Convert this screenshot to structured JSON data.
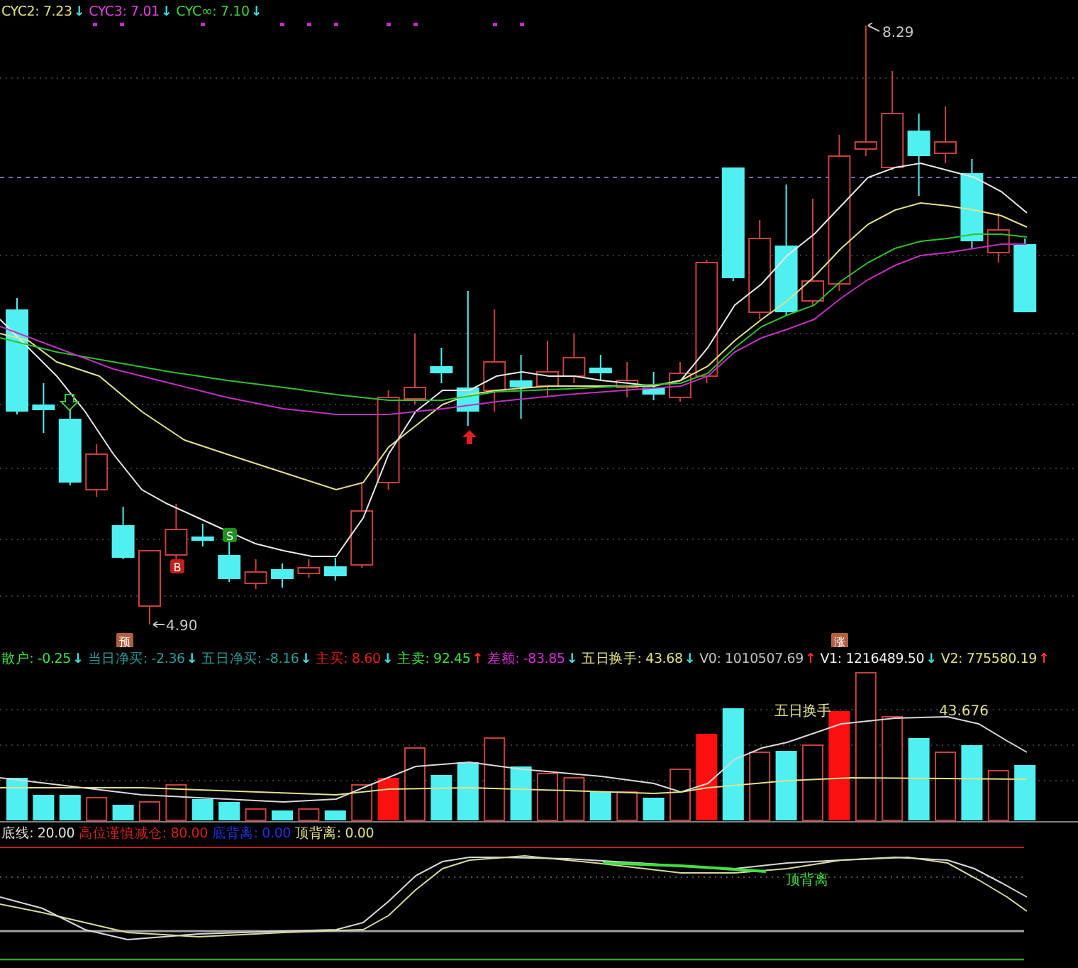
{
  "price_legend": [
    {
      "label": "CYC2:",
      "value": "7.23",
      "arrow": "↓",
      "rising": false,
      "color": "#e0e080"
    },
    {
      "label": "CYC3:",
      "value": "7.01",
      "arrow": "↓",
      "rising": false,
      "color": "#e040e0"
    },
    {
      "label": "CYC∞:",
      "value": "7.10",
      "arrow": "↓",
      "rising": false,
      "color": "#40d040"
    }
  ],
  "price_chart": {
    "high_label": "8.29",
    "low_label": "4.90",
    "buy_badge": "B",
    "sell_badge": "S",
    "marker_1": "预",
    "marker_2": "涨"
  },
  "indicator_legend": [
    {
      "label": "散户:",
      "value": "-0.25",
      "arrow": "↓",
      "rising": false,
      "color": "#40e040"
    },
    {
      "label": "当日净买:",
      "value": "-2.36",
      "arrow": "↓",
      "rising": false,
      "color": "#2a9a9a"
    },
    {
      "label": "五日净买:",
      "value": "-8.16",
      "arrow": "↓",
      "rising": false,
      "color": "#2a9a9a"
    },
    {
      "label": "主买:",
      "value": "8.60",
      "arrow": "↓",
      "rising": false,
      "color": "#e02020"
    },
    {
      "label": "主卖:",
      "value": "92.45",
      "arrow": "↑",
      "rising": true,
      "color": "#40e040"
    },
    {
      "label": "差额:",
      "value": "-83.85",
      "arrow": "↓",
      "rising": false,
      "color": "#d030d0"
    },
    {
      "label": "五日换手:",
      "value": "43.68",
      "arrow": "↓",
      "rising": false,
      "color": "#e0e080"
    },
    {
      "label": "V0:",
      "value": "1010507.69",
      "arrow": "↑",
      "rising": true,
      "color": "#c0c0c0"
    },
    {
      "label": "V1:",
      "value": "1216489.50",
      "arrow": "↓",
      "rising": false,
      "color": "#f0f0f0"
    },
    {
      "label": "V2:",
      "value": "775580.19",
      "arrow": "↑",
      "rising": true,
      "color": "#e0e080"
    }
  ],
  "volume_chart": {
    "line_label": "五日换手",
    "line_value": "43.676"
  },
  "oscillator_legend": [
    {
      "label": "底线:",
      "value": "20.00",
      "color": "#e0e0e0"
    },
    {
      "label": "高位谨慎减仓:",
      "value": "80.00",
      "color": "#d02020"
    },
    {
      "label": "底背离:",
      "value": "0.00",
      "color": "#2030e0"
    },
    {
      "label": "顶背离:",
      "value": "0.00",
      "color": "#e0e080"
    }
  ],
  "oscillator_chart": {
    "divergence_label": "顶背离"
  }
}
